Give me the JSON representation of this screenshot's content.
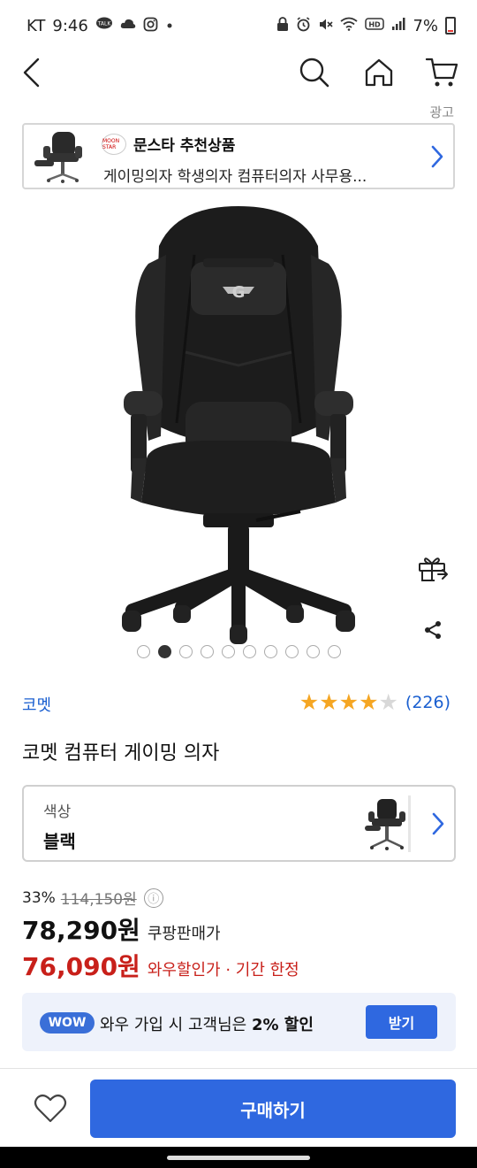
{
  "status_bar": {
    "carrier": "KT",
    "time": "9:46",
    "battery": "7%",
    "left_icons": [
      "talk-icon",
      "cloud-icon",
      "instagram-icon",
      "dot-icon"
    ],
    "right_icons": [
      "lock-icon",
      "alarm-icon",
      "mute-icon",
      "wifi-icon",
      "hd-icon",
      "signal-icon",
      "battery-icon"
    ]
  },
  "nav": {
    "icons": [
      "back-icon",
      "search-icon",
      "home-icon",
      "cart-icon"
    ]
  },
  "ad": {
    "label": "광고",
    "logo_text": "MOON STAR",
    "title": "문스타 추천상품",
    "subtitle": "게이밍의자 학생의자 컴퓨터의자 사무용..."
  },
  "gallery": {
    "image_count": 10,
    "active_index": 1
  },
  "product": {
    "brand": "코멧",
    "rating_stars": 4,
    "rating_max": 5,
    "review_count": "(226)",
    "title": "코멧 컴퓨터 게이밍 의자"
  },
  "option": {
    "label": "색상",
    "value": "블랙"
  },
  "price": {
    "discount": "33%",
    "original": "114,150원",
    "info_icon": "ⓘ",
    "sale": "78,290원",
    "sale_label": "쿠팡판매가",
    "wow": "76,090원",
    "wow_label": "와우할인가 · 기간 한정"
  },
  "wow_promo": {
    "badge": "WOW",
    "text_prefix": "와우 가입 시 고객님은",
    "text_bold": "2% 할인",
    "button": "받기"
  },
  "bottom": {
    "buy_button": "구매하기"
  },
  "colors": {
    "primary": "#2f68e0",
    "brand_link": "#1a5fd0",
    "wow_price": "#c8201a",
    "star": "#f5a623",
    "star_empty": "#d8d8d8"
  }
}
